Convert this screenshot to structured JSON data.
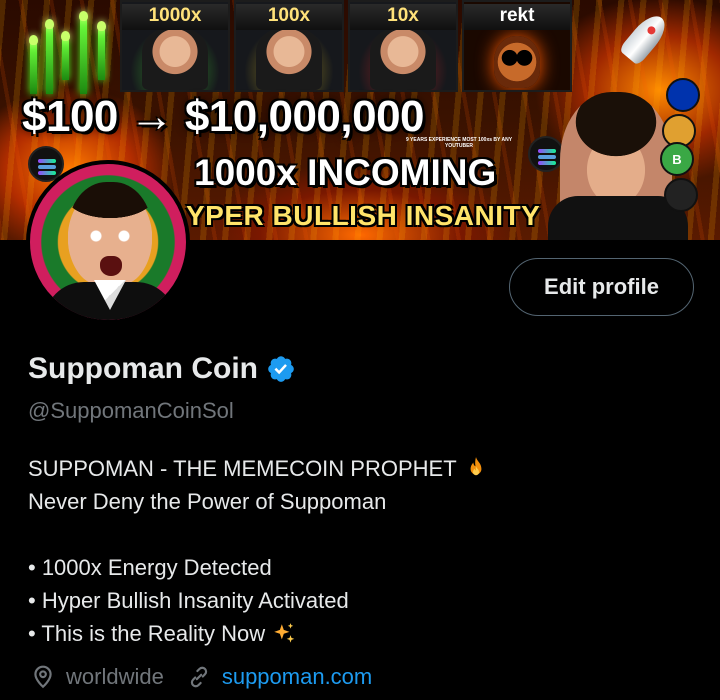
{
  "banner": {
    "thumbnails": [
      {
        "label": "1000x"
      },
      {
        "label": "100x"
      },
      {
        "label": "10x"
      },
      {
        "label": "rekt"
      }
    ],
    "headline": "$100 → $10,000,000",
    "experience_text": "9 YEARS EXPERIENCE MOST 100xs BY ANY YOUTUBER",
    "incoming_text": "1000x INCOMING",
    "hyper_text": "YPER BULLISH INSANITY",
    "coin_b_label": "B"
  },
  "profile": {
    "edit_button_label": "Edit profile",
    "display_name": "Suppoman Coin",
    "verified": true,
    "handle": "@SuppomanCoinSol",
    "bio": {
      "line1": "SUPPOMAN - THE MEMECOIN PROPHET",
      "line2": "Never Deny the Power of Suppoman",
      "bullet1": "• 1000x Energy Detected",
      "bullet2": "• Hyper Bullish Insanity Activated",
      "bullet3": "• This is the Reality Now"
    },
    "location": "worldwide",
    "website": "suppoman.com"
  },
  "icons": {
    "verified": "verified-badge-icon",
    "fire": "fire-emoji-icon",
    "sparkles": "sparkles-emoji-icon",
    "location": "location-pin-icon",
    "link": "link-icon"
  },
  "colors": {
    "background": "#000000",
    "text_primary": "#e7e9ea",
    "text_secondary": "#71767b",
    "link": "#1d9bf0",
    "verified": "#1d9bf0",
    "button_border": "#536471"
  }
}
